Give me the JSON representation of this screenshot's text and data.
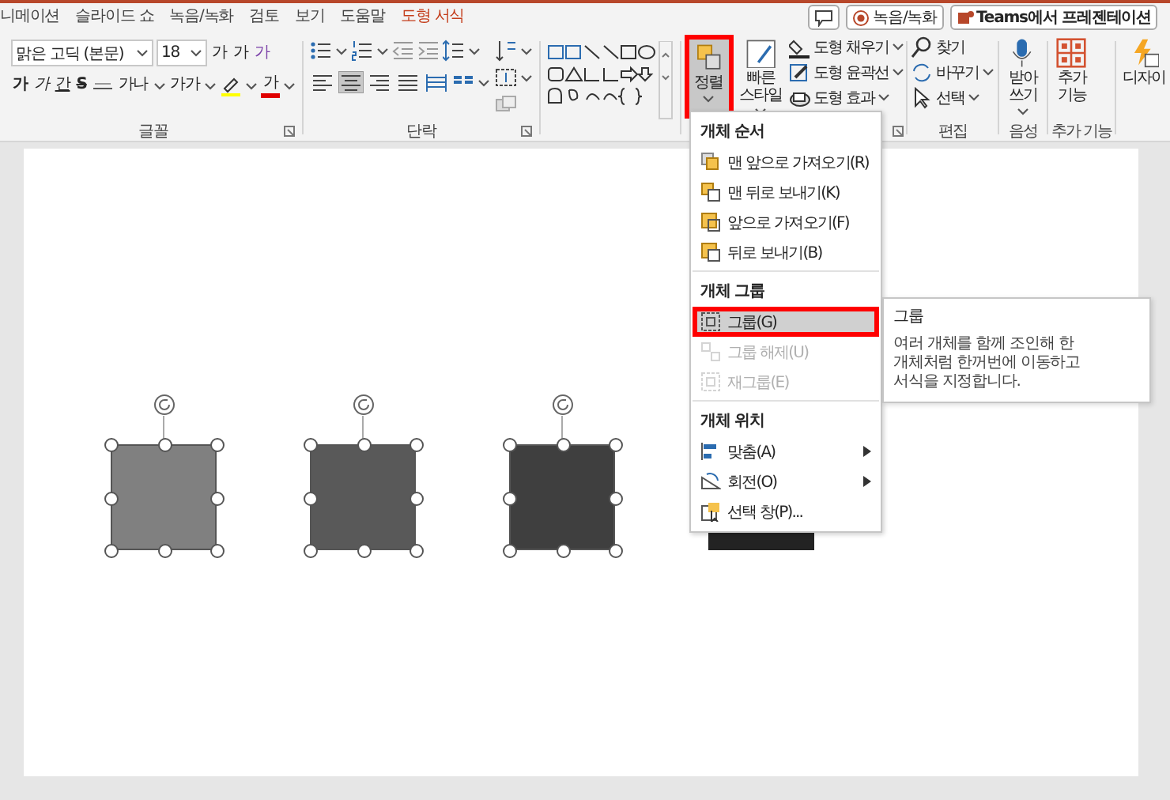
{
  "tabs": [
    {
      "label": "니메이션",
      "selected": false
    },
    {
      "label": "슬라이드 쇼",
      "selected": false
    },
    {
      "label": "녹음/녹화",
      "selected": false
    },
    {
      "label": "검토",
      "selected": false
    },
    {
      "label": "보기",
      "selected": false
    },
    {
      "label": "도움말",
      "selected": false
    },
    {
      "label": "도형 서식",
      "selected": true
    }
  ],
  "title_buttons": [
    {
      "kind": "comment"
    },
    {
      "kind": "record",
      "label": "녹음/녹화"
    },
    {
      "kind": "teams",
      "label": "Teams에서 프레젠테이션"
    }
  ],
  "ribbon": {
    "groups": [
      {
        "kind": "font",
        "label": "글꼴",
        "font_name": "맑은 고딕 (본문)",
        "font_size": "18",
        "size_buttons": [
          {
            "kind": "grow",
            "label": "가"
          },
          {
            "kind": "shrink",
            "label": "가"
          },
          {
            "kind": "clear",
            "label": "가"
          }
        ],
        "format_buttons": [
          {
            "kind": "bold",
            "label": "가"
          },
          {
            "kind": "italic",
            "label": "가"
          },
          {
            "kind": "underline",
            "label": "간"
          },
          {
            "kind": "strike",
            "label": "S"
          },
          {
            "kind": "spacing",
            "label": "가나"
          },
          {
            "kind": "case",
            "label": "가가"
          },
          {
            "kind": "color",
            "label": "가"
          }
        ]
      },
      {
        "kind": "paragraph",
        "label": "단락",
        "align_buttons": [
          {
            "selected": false
          },
          {
            "selected": true
          },
          {
            "selected": false
          },
          {
            "selected": false
          },
          {
            "selected": false
          }
        ]
      },
      {
        "kind": "shapes"
      },
      {
        "kind": "arrange",
        "large_buttons": [
          {
            "lines": [
              "정렬"
            ],
            "pressed": true,
            "highlight": true
          },
          {
            "lines": [
              "빠른",
              "스타일"
            ],
            "pressed": false,
            "highlight": false
          }
        ],
        "small_buttons": [
          {
            "kind": "fill",
            "label": "도형 채우기"
          },
          {
            "kind": "outline",
            "label": "도형 윤곽선"
          },
          {
            "kind": "effects",
            "label": "도형 효과"
          }
        ]
      },
      {
        "kind": "edit",
        "label": "편집",
        "small_buttons": [
          {
            "kind": "find",
            "label": "찾기"
          },
          {
            "kind": "replace",
            "label": "바꾸기"
          },
          {
            "kind": "select",
            "label": "선택"
          }
        ]
      },
      {
        "kind": "voice",
        "label": "음성",
        "lines": [
          "받아",
          "쓰기"
        ]
      },
      {
        "kind": "addins",
        "label": "추가 기능",
        "lines": [
          "추가",
          "기능"
        ]
      },
      {
        "kind": "designer",
        "lines": [
          "디자이"
        ]
      }
    ]
  },
  "slide": {
    "shapes": [
      {
        "color": "#808080",
        "selected": true
      },
      {
        "color": "#595959",
        "selected": true
      },
      {
        "color": "#3f3f3f",
        "selected": true
      },
      {
        "color": "#232323",
        "selected": false
      }
    ]
  },
  "menu": {
    "sections": [
      {
        "header": "개체 순서",
        "items": [
          {
            "kind": "front",
            "label": "맨 앞으로 가져오기(R)",
            "selected": false,
            "disabled": false,
            "highlight": false,
            "submenu": false
          },
          {
            "kind": "back",
            "label": "맨 뒤로 보내기(K)",
            "selected": false,
            "disabled": false,
            "highlight": false,
            "submenu": false
          },
          {
            "kind": "forward",
            "label": "앞으로 가져오기(F)",
            "selected": false,
            "disabled": false,
            "highlight": false,
            "submenu": false
          },
          {
            "kind": "backward",
            "label": "뒤로 보내기(B)",
            "selected": false,
            "disabled": false,
            "highlight": false,
            "submenu": false
          }
        ]
      },
      {
        "header": "개체 그룹",
        "items": [
          {
            "kind": "group",
            "label": "그룹(G)",
            "selected": true,
            "disabled": false,
            "highlight": true,
            "submenu": false
          },
          {
            "kind": "ungroup",
            "label": "그룹 해제(U)",
            "selected": false,
            "disabled": true,
            "highlight": false,
            "submenu": false
          },
          {
            "kind": "regroup",
            "label": "재그룹(E)",
            "selected": false,
            "disabled": true,
            "highlight": false,
            "submenu": false
          }
        ]
      },
      {
        "header": "개체 위치",
        "items": [
          {
            "kind": "align",
            "label": "맞춤(A)",
            "selected": false,
            "disabled": false,
            "highlight": false,
            "submenu": true
          },
          {
            "kind": "rotate",
            "label": "회전(O)",
            "selected": false,
            "disabled": false,
            "highlight": false,
            "submenu": true
          },
          {
            "kind": "pane",
            "label": "선택 창(P)...",
            "selected": false,
            "disabled": false,
            "highlight": false,
            "submenu": false
          }
        ]
      }
    ]
  },
  "tooltip": {
    "title": "그룹",
    "text": "여러 개체를 함께 조인해 한 개체처럼 한꺼번에 이동하고 서식을 지정합니다."
  }
}
